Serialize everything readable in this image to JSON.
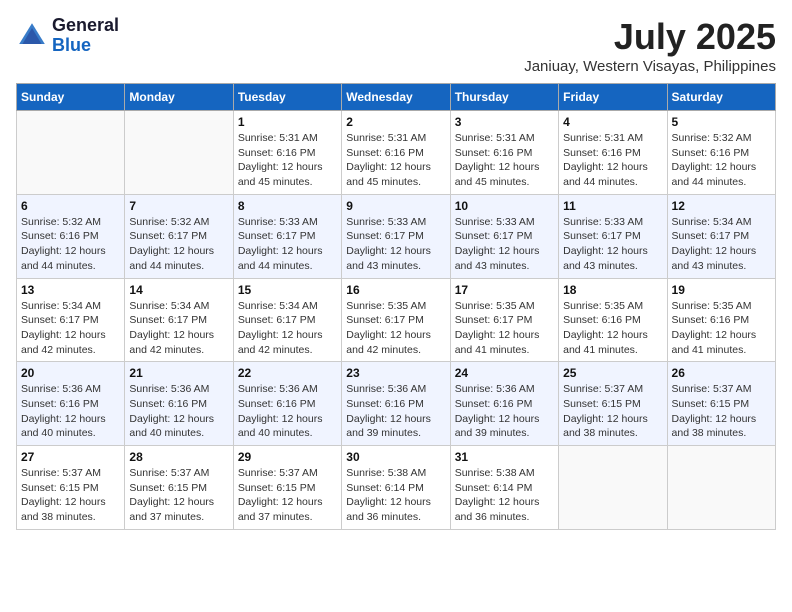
{
  "header": {
    "logo_general": "General",
    "logo_blue": "Blue",
    "month_year": "July 2025",
    "location": "Janiuay, Western Visayas, Philippines"
  },
  "days_of_week": [
    "Sunday",
    "Monday",
    "Tuesday",
    "Wednesday",
    "Thursday",
    "Friday",
    "Saturday"
  ],
  "weeks": [
    [
      {
        "day": "",
        "info": ""
      },
      {
        "day": "",
        "info": ""
      },
      {
        "day": "1",
        "info": "Sunrise: 5:31 AM\nSunset: 6:16 PM\nDaylight: 12 hours and 45 minutes."
      },
      {
        "day": "2",
        "info": "Sunrise: 5:31 AM\nSunset: 6:16 PM\nDaylight: 12 hours and 45 minutes."
      },
      {
        "day": "3",
        "info": "Sunrise: 5:31 AM\nSunset: 6:16 PM\nDaylight: 12 hours and 45 minutes."
      },
      {
        "day": "4",
        "info": "Sunrise: 5:31 AM\nSunset: 6:16 PM\nDaylight: 12 hours and 44 minutes."
      },
      {
        "day": "5",
        "info": "Sunrise: 5:32 AM\nSunset: 6:16 PM\nDaylight: 12 hours and 44 minutes."
      }
    ],
    [
      {
        "day": "6",
        "info": "Sunrise: 5:32 AM\nSunset: 6:16 PM\nDaylight: 12 hours and 44 minutes."
      },
      {
        "day": "7",
        "info": "Sunrise: 5:32 AM\nSunset: 6:17 PM\nDaylight: 12 hours and 44 minutes."
      },
      {
        "day": "8",
        "info": "Sunrise: 5:33 AM\nSunset: 6:17 PM\nDaylight: 12 hours and 44 minutes."
      },
      {
        "day": "9",
        "info": "Sunrise: 5:33 AM\nSunset: 6:17 PM\nDaylight: 12 hours and 43 minutes."
      },
      {
        "day": "10",
        "info": "Sunrise: 5:33 AM\nSunset: 6:17 PM\nDaylight: 12 hours and 43 minutes."
      },
      {
        "day": "11",
        "info": "Sunrise: 5:33 AM\nSunset: 6:17 PM\nDaylight: 12 hours and 43 minutes."
      },
      {
        "day": "12",
        "info": "Sunrise: 5:34 AM\nSunset: 6:17 PM\nDaylight: 12 hours and 43 minutes."
      }
    ],
    [
      {
        "day": "13",
        "info": "Sunrise: 5:34 AM\nSunset: 6:17 PM\nDaylight: 12 hours and 42 minutes."
      },
      {
        "day": "14",
        "info": "Sunrise: 5:34 AM\nSunset: 6:17 PM\nDaylight: 12 hours and 42 minutes."
      },
      {
        "day": "15",
        "info": "Sunrise: 5:34 AM\nSunset: 6:17 PM\nDaylight: 12 hours and 42 minutes."
      },
      {
        "day": "16",
        "info": "Sunrise: 5:35 AM\nSunset: 6:17 PM\nDaylight: 12 hours and 42 minutes."
      },
      {
        "day": "17",
        "info": "Sunrise: 5:35 AM\nSunset: 6:17 PM\nDaylight: 12 hours and 41 minutes."
      },
      {
        "day": "18",
        "info": "Sunrise: 5:35 AM\nSunset: 6:16 PM\nDaylight: 12 hours and 41 minutes."
      },
      {
        "day": "19",
        "info": "Sunrise: 5:35 AM\nSunset: 6:16 PM\nDaylight: 12 hours and 41 minutes."
      }
    ],
    [
      {
        "day": "20",
        "info": "Sunrise: 5:36 AM\nSunset: 6:16 PM\nDaylight: 12 hours and 40 minutes."
      },
      {
        "day": "21",
        "info": "Sunrise: 5:36 AM\nSunset: 6:16 PM\nDaylight: 12 hours and 40 minutes."
      },
      {
        "day": "22",
        "info": "Sunrise: 5:36 AM\nSunset: 6:16 PM\nDaylight: 12 hours and 40 minutes."
      },
      {
        "day": "23",
        "info": "Sunrise: 5:36 AM\nSunset: 6:16 PM\nDaylight: 12 hours and 39 minutes."
      },
      {
        "day": "24",
        "info": "Sunrise: 5:36 AM\nSunset: 6:16 PM\nDaylight: 12 hours and 39 minutes."
      },
      {
        "day": "25",
        "info": "Sunrise: 5:37 AM\nSunset: 6:15 PM\nDaylight: 12 hours and 38 minutes."
      },
      {
        "day": "26",
        "info": "Sunrise: 5:37 AM\nSunset: 6:15 PM\nDaylight: 12 hours and 38 minutes."
      }
    ],
    [
      {
        "day": "27",
        "info": "Sunrise: 5:37 AM\nSunset: 6:15 PM\nDaylight: 12 hours and 38 minutes."
      },
      {
        "day": "28",
        "info": "Sunrise: 5:37 AM\nSunset: 6:15 PM\nDaylight: 12 hours and 37 minutes."
      },
      {
        "day": "29",
        "info": "Sunrise: 5:37 AM\nSunset: 6:15 PM\nDaylight: 12 hours and 37 minutes."
      },
      {
        "day": "30",
        "info": "Sunrise: 5:38 AM\nSunset: 6:14 PM\nDaylight: 12 hours and 36 minutes."
      },
      {
        "day": "31",
        "info": "Sunrise: 5:38 AM\nSunset: 6:14 PM\nDaylight: 12 hours and 36 minutes."
      },
      {
        "day": "",
        "info": ""
      },
      {
        "day": "",
        "info": ""
      }
    ]
  ]
}
